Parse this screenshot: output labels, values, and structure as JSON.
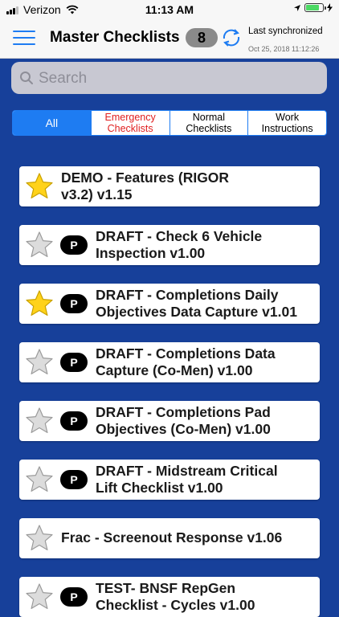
{
  "status_bar": {
    "carrier": "Verizon",
    "time": "11:13 AM",
    "battery_percent": 85,
    "battery_color": "#4cd964"
  },
  "header": {
    "title": "Master Checklists",
    "count": "8",
    "sync_label": "Last synchronized",
    "sync_time": "Oct 25, 2018 11:12:26",
    "accent_color": "#1e7cf2"
  },
  "search": {
    "placeholder": "Search",
    "value": ""
  },
  "tabs": [
    {
      "label": "All",
      "active": true
    },
    {
      "label": "Emergency\nChecklists",
      "active": false,
      "color": "#e02020"
    },
    {
      "label": "Normal\nChecklists",
      "active": false
    },
    {
      "label": "Work\nInstructions",
      "active": false
    }
  ],
  "checklists": [
    {
      "title": "DEMO - Features (RIGOR\nv3.2) v1.15",
      "favorite": true,
      "badge": ""
    },
    {
      "title": "DRAFT - Check 6 Vehicle\nInspection v1.00",
      "favorite": false,
      "badge": "P"
    },
    {
      "title": "DRAFT - Completions Daily\nObjectives Data Capture v1.01",
      "favorite": true,
      "badge": "P"
    },
    {
      "title": "DRAFT - Completions Data\nCapture (Co-Men) v1.00",
      "favorite": false,
      "badge": "P"
    },
    {
      "title": "DRAFT - Completions Pad\nObjectives (Co-Men) v1.00",
      "favorite": false,
      "badge": "P"
    },
    {
      "title": "DRAFT - Midstream Critical\nLift Checklist v1.00",
      "favorite": false,
      "badge": "P"
    },
    {
      "title": "Frac - Screenout Response v1.06",
      "favorite": false,
      "badge": ""
    },
    {
      "title": "TEST- BNSF RepGen\nChecklist - Cycles v1.00",
      "favorite": false,
      "badge": "P"
    }
  ]
}
